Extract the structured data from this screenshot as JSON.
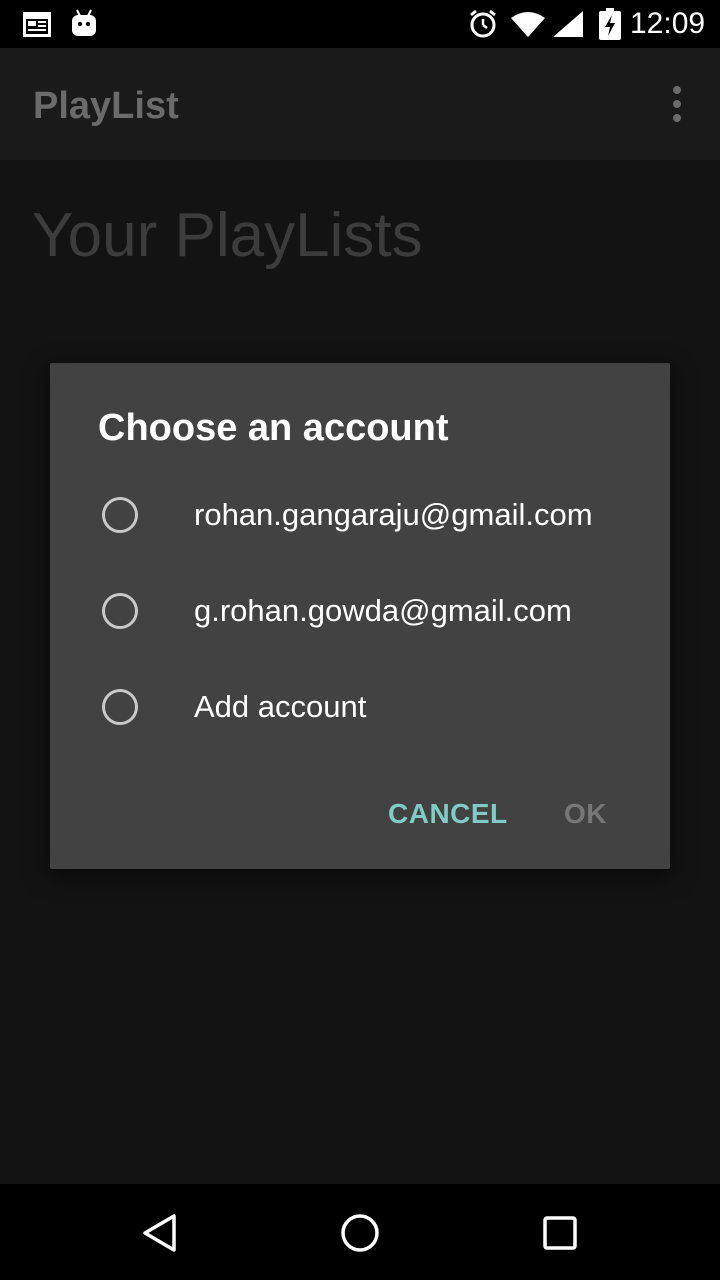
{
  "status_bar": {
    "time": "12:09",
    "icons": [
      "calendar-icon",
      "android-icon",
      "alarm-icon",
      "wifi-icon",
      "signal-icon",
      "battery-charging-icon"
    ]
  },
  "app_bar": {
    "title": "PlayList",
    "menu_icon": "overflow-menu-icon"
  },
  "main": {
    "heading": "Your PlayLists"
  },
  "dialog": {
    "title": "Choose an account",
    "options": [
      {
        "label": "rohan.gangaraju@gmail.com",
        "selected": false
      },
      {
        "label": "g.rohan.gowda@gmail.com",
        "selected": false
      },
      {
        "label": "Add account",
        "selected": false
      }
    ],
    "cancel_label": "CANCEL",
    "ok_label": "OK",
    "accent_color": "#80cbc4"
  },
  "nav_bar": {
    "icons": [
      "back-icon",
      "home-icon",
      "recents-icon"
    ]
  }
}
